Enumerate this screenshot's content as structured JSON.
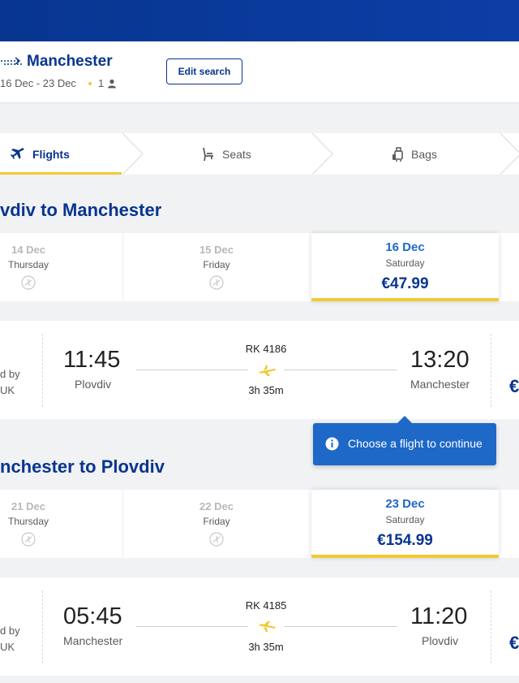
{
  "header": {
    "destination": "Manchester",
    "dates": "16 Dec - 23 Dec",
    "passengers": "1",
    "edit_search_label": "Edit search"
  },
  "steps": [
    {
      "label": "Flights",
      "icon": "plane-icon",
      "active": true
    },
    {
      "label": "Seats",
      "icon": "seat-icon",
      "active": false
    },
    {
      "label": "Bags",
      "icon": "bag-icon",
      "active": false
    }
  ],
  "outbound": {
    "title": "vdiv to Manchester",
    "dates": [
      {
        "date": "14 Dec",
        "weekday": "Thursday",
        "price": null
      },
      {
        "date": "15 Dec",
        "weekday": "Friday",
        "price": null
      },
      {
        "date": "16 Dec",
        "weekday": "Saturday",
        "price": "€47.99",
        "selected": true
      }
    ],
    "flight": {
      "operator_line1": "d by",
      "operator_line2": "UK",
      "depart_time": "11:45",
      "depart_city": "Plovdiv",
      "flight_number": "RK 4186",
      "duration": "3h 35m",
      "arrive_time": "13:20",
      "arrive_city": "Manchester",
      "price_partial": "€"
    }
  },
  "tooltip": {
    "text": "Choose a flight to continue"
  },
  "inbound": {
    "title": "nchester to Plovdiv",
    "dates": [
      {
        "date": "21 Dec",
        "weekday": "Thursday",
        "price": null
      },
      {
        "date": "22 Dec",
        "weekday": "Friday",
        "price": null
      },
      {
        "date": "23 Dec",
        "weekday": "Saturday",
        "price": "€154.99",
        "selected": true
      }
    ],
    "flight": {
      "operator_line1": "d by",
      "operator_line2": "UK",
      "depart_time": "05:45",
      "depart_city": "Manchester",
      "flight_number": "RK 4185",
      "duration": "3h 35m",
      "arrive_time": "11:20",
      "arrive_city": "Plovdiv",
      "price_partial": "€"
    }
  },
  "colors": {
    "brand_blue": "#073590",
    "accent_yellow": "#f1c933",
    "info_blue": "#1e68c7"
  }
}
